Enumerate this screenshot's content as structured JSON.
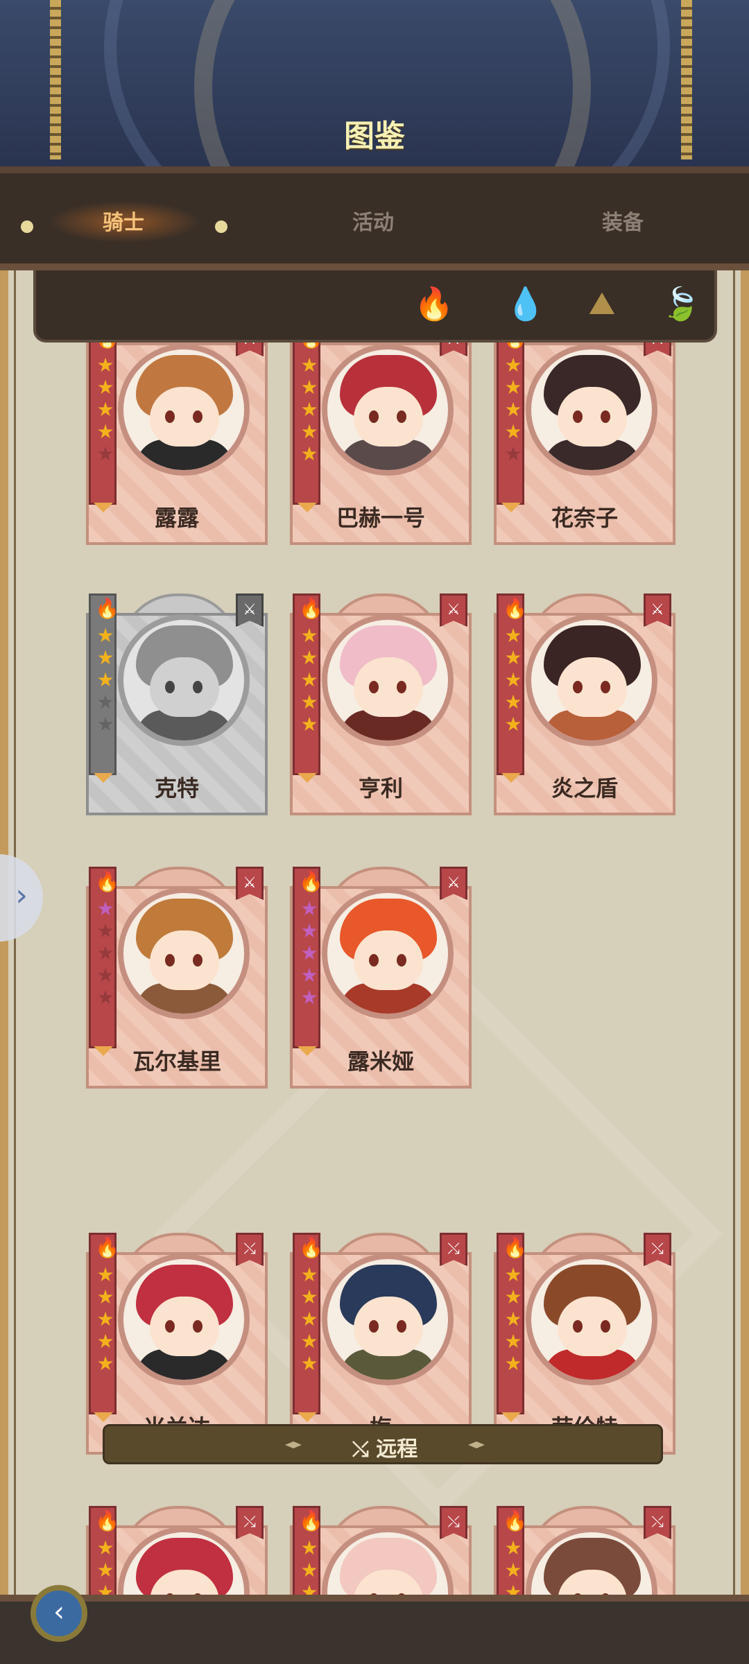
{
  "header": {
    "title": "图鉴"
  },
  "tabs": [
    {
      "label": "骑士",
      "active": true
    },
    {
      "label": "活动",
      "active": false
    },
    {
      "label": "装备",
      "active": false
    }
  ],
  "filters": [
    {
      "icon": "fire-element-icon",
      "glyph": "🔥",
      "color": "#d6433f"
    },
    {
      "icon": "water-element-icon",
      "glyph": "💧",
      "color": "#2f5fb0"
    },
    {
      "icon": "earth-element-icon",
      "glyph": "⛰",
      "color": "#b0904a"
    },
    {
      "icon": "wind-element-icon",
      "glyph": "🍃",
      "color": "#5a9a3a"
    }
  ],
  "section": {
    "label": "远程",
    "icon": "bow-icon"
  },
  "cards": [
    {
      "name": "露露",
      "stars": 4,
      "type": "sword",
      "locked": false,
      "hair": "#c07840",
      "outfit": "#2a2a2a"
    },
    {
      "name": "巴赫一号",
      "stars": 5,
      "type": "sword",
      "locked": false,
      "hair": "#b8313a",
      "outfit": "#5a4a4a"
    },
    {
      "name": "花奈子",
      "stars": 4,
      "type": "sword",
      "locked": false,
      "hair": "#3a2828",
      "outfit": "#3a2a2a"
    },
    {
      "name": "克特",
      "stars": 3,
      "type": "sword",
      "locked": true,
      "hair": "#8a8a8a",
      "outfit": "#555555"
    },
    {
      "name": "亨利",
      "stars": 5,
      "type": "sword",
      "locked": false,
      "hair": "#efbcc8",
      "outfit": "#6a2a24"
    },
    {
      "name": "炎之盾",
      "stars": 5,
      "type": "sword",
      "locked": false,
      "hair": "#3a2424",
      "outfit": "#b8603a"
    },
    {
      "name": "瓦尔基里",
      "stars": 1,
      "type": "sword",
      "locked": false,
      "hair": "#c07a3a",
      "outfit": "#8a5a3a"
    },
    {
      "name": "露米娅",
      "stars": 5,
      "type": "sword",
      "locked": false,
      "hair": "#e8582a",
      "outfit": "#a83a2a"
    },
    {
      "name": "米兰达",
      "stars": 5,
      "type": "bow",
      "locked": false,
      "hair": "#c03040",
      "outfit": "#2a2a2a"
    },
    {
      "name": "梅",
      "stars": 5,
      "type": "bow",
      "locked": false,
      "hair": "#2a3a5a",
      "outfit": "#5a5a3a"
    },
    {
      "name": "劳伦特",
      "stars": 5,
      "type": "bow",
      "locked": false,
      "hair": "#8a4a2a",
      "outfit": "#c02a2a"
    },
    {
      "name": "",
      "stars": 5,
      "type": "bow",
      "locked": false,
      "hair": "#c03040",
      "outfit": "#2a2a2a"
    },
    {
      "name": "",
      "stars": 5,
      "type": "bow",
      "locked": false,
      "hair": "#f2c8c0",
      "outfit": "#5a5a3a"
    },
    {
      "name": "",
      "stars": 5,
      "type": "bow",
      "locked": false,
      "hair": "#7a4a3a",
      "outfit": "#c02a2a"
    }
  ],
  "colors": {
    "star_gold": "#f3b21c",
    "star_purple": "#c060c0",
    "accent": "#f5c27a"
  }
}
